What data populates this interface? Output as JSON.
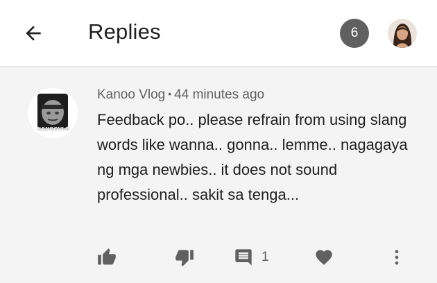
{
  "header": {
    "title": "Replies",
    "reply_count": "6",
    "back_icon": "arrow-left-icon"
  },
  "comment": {
    "author": "Kanoo Vlog",
    "separator": "•",
    "time": "44 minutes ago",
    "text": "Feedback po.. please refrain from using slang words like wanna.. gonna.. lemme.. nagagaya ng mga newbies.. it does not sound professional.. sakit sa tenga...",
    "avatar_label": "KANOOVLO",
    "actions": {
      "like_icon": "thumbs-up-icon",
      "dislike_icon": "thumbs-down-icon",
      "reply_icon": "comment-icon",
      "reply_count": "1",
      "heart_icon": "heart-icon",
      "more_icon": "more-vert-icon"
    }
  },
  "colors": {
    "background": "#f4f4f4",
    "appbar": "#ffffff",
    "badge": "#606060",
    "text_primary": "#212121",
    "text_secondary": "#606060",
    "icon": "#606060"
  }
}
